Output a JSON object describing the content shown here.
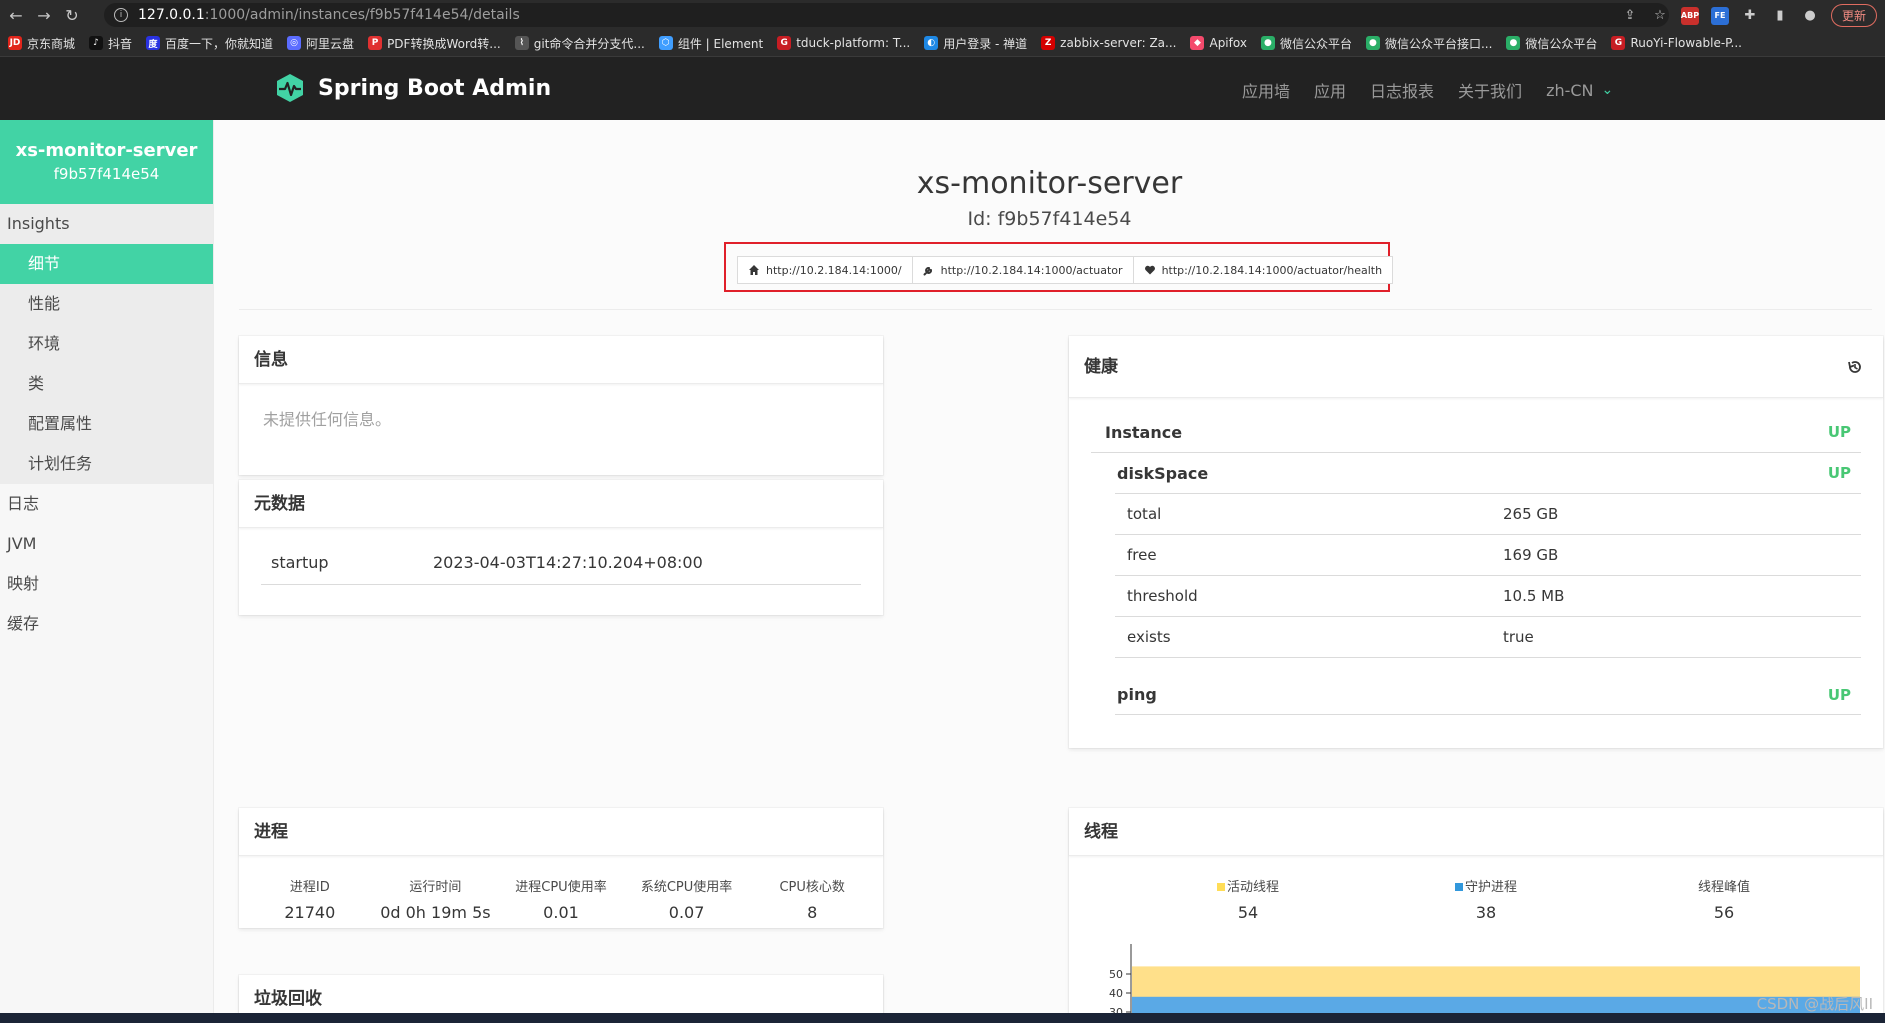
{
  "browser": {
    "url_host": "127.0.0.1",
    "url_path": ":1000/admin/instances/f9b57f414e54/details",
    "update_label": "更新",
    "bookmarks": [
      {
        "label": "京东商城",
        "icon": "JD",
        "color": "#e1251b"
      },
      {
        "label": "抖音",
        "icon": "♪",
        "color": "#111111"
      },
      {
        "label": "百度一下，你就知道",
        "icon": "度",
        "color": "#2932e1"
      },
      {
        "label": "阿里云盘",
        "icon": "◎",
        "color": "#5b6cff"
      },
      {
        "label": "PDF转换成Word转...",
        "icon": "P",
        "color": "#e03131"
      },
      {
        "label": "git命令合并分支代...",
        "icon": "⌇",
        "color": "#555555"
      },
      {
        "label": "组件 | Element",
        "icon": "⬡",
        "color": "#409eff"
      },
      {
        "label": "tduck-platform: T...",
        "icon": "G",
        "color": "#c71d23"
      },
      {
        "label": "用户登录 - 禅道",
        "icon": "◐",
        "color": "#1e88e5"
      },
      {
        "label": "zabbix-server: Za...",
        "icon": "Z",
        "color": "#d40000"
      },
      {
        "label": "Apifox",
        "icon": "◆",
        "color": "#f44a6c"
      },
      {
        "label": "微信公众平台",
        "icon": "●",
        "color": "#2aae67"
      },
      {
        "label": "微信公众平台接口...",
        "icon": "●",
        "color": "#2aae67"
      },
      {
        "label": "微信公众平台",
        "icon": "●",
        "color": "#2aae67"
      },
      {
        "label": "RuoYi-Flowable-P...",
        "icon": "G",
        "color": "#c71d23"
      }
    ]
  },
  "navbar": {
    "brand": "Spring Boot Admin",
    "links": [
      "应用墙",
      "应用",
      "日志报表",
      "关于我们"
    ],
    "lang": "zh-CN"
  },
  "sidebar": {
    "app_name": "xs-monitor-server",
    "instance_id": "f9b57f414e54",
    "group_title": "Insights",
    "group_items": [
      "细节",
      "性能",
      "环境",
      "类",
      "配置属性",
      "计划任务"
    ],
    "top_items": [
      "日志",
      "JVM",
      "映射",
      "缓存"
    ]
  },
  "header": {
    "title": "xs-monitor-server",
    "id_text": "Id: f9b57f414e54",
    "urls": [
      {
        "icon": "home-icon",
        "label": "http://10.2.184.14:1000/"
      },
      {
        "icon": "wrench-icon",
        "label": "http://10.2.184.14:1000/actuator"
      },
      {
        "icon": "heart-icon",
        "label": "http://10.2.184.14:1000/actuator/health"
      }
    ]
  },
  "info_card": {
    "title": "信息",
    "empty_text": "未提供任何信息。"
  },
  "metadata_card": {
    "title": "元数据",
    "rows": [
      {
        "key": "startup",
        "value": "2023-04-03T14:27:10.204+08:00"
      }
    ]
  },
  "health_card": {
    "title": "健康",
    "instance_label": "Instance",
    "instance_status": "UP",
    "disk_label": "diskSpace",
    "disk_status": "UP",
    "disk_details": [
      {
        "key": "total",
        "value": "265 GB"
      },
      {
        "key": "free",
        "value": "169 GB"
      },
      {
        "key": "threshold",
        "value": "10.5 MB"
      },
      {
        "key": "exists",
        "value": "true"
      }
    ],
    "ping_label": "ping",
    "ping_status": "UP"
  },
  "process_card": {
    "title": "进程",
    "stats": [
      {
        "label": "进程ID",
        "value": "21740"
      },
      {
        "label": "运行时间",
        "value": "0d 0h 19m 5s"
      },
      {
        "label": "进程CPU使用率",
        "value": "0.01"
      },
      {
        "label": "系统CPU使用率",
        "value": "0.07"
      },
      {
        "label": "CPU核心数",
        "value": "8"
      }
    ]
  },
  "gc_card": {
    "title": "垃圾回收"
  },
  "threads_card": {
    "title": "线程",
    "stats": [
      {
        "label": "活动线程",
        "value": "54",
        "color": "#ffdd57"
      },
      {
        "label": "守护进程",
        "value": "38",
        "color": "#3298dc"
      },
      {
        "label": "线程峰值",
        "value": "56",
        "color": ""
      }
    ],
    "chart": {
      "type": "area",
      "ticks": [
        50,
        40,
        30
      ],
      "live": 54,
      "daemon": 38,
      "live_color": "#ffe08a",
      "daemon_color": "#5aa9e6"
    }
  },
  "watermark": "CSDN @战后风II"
}
